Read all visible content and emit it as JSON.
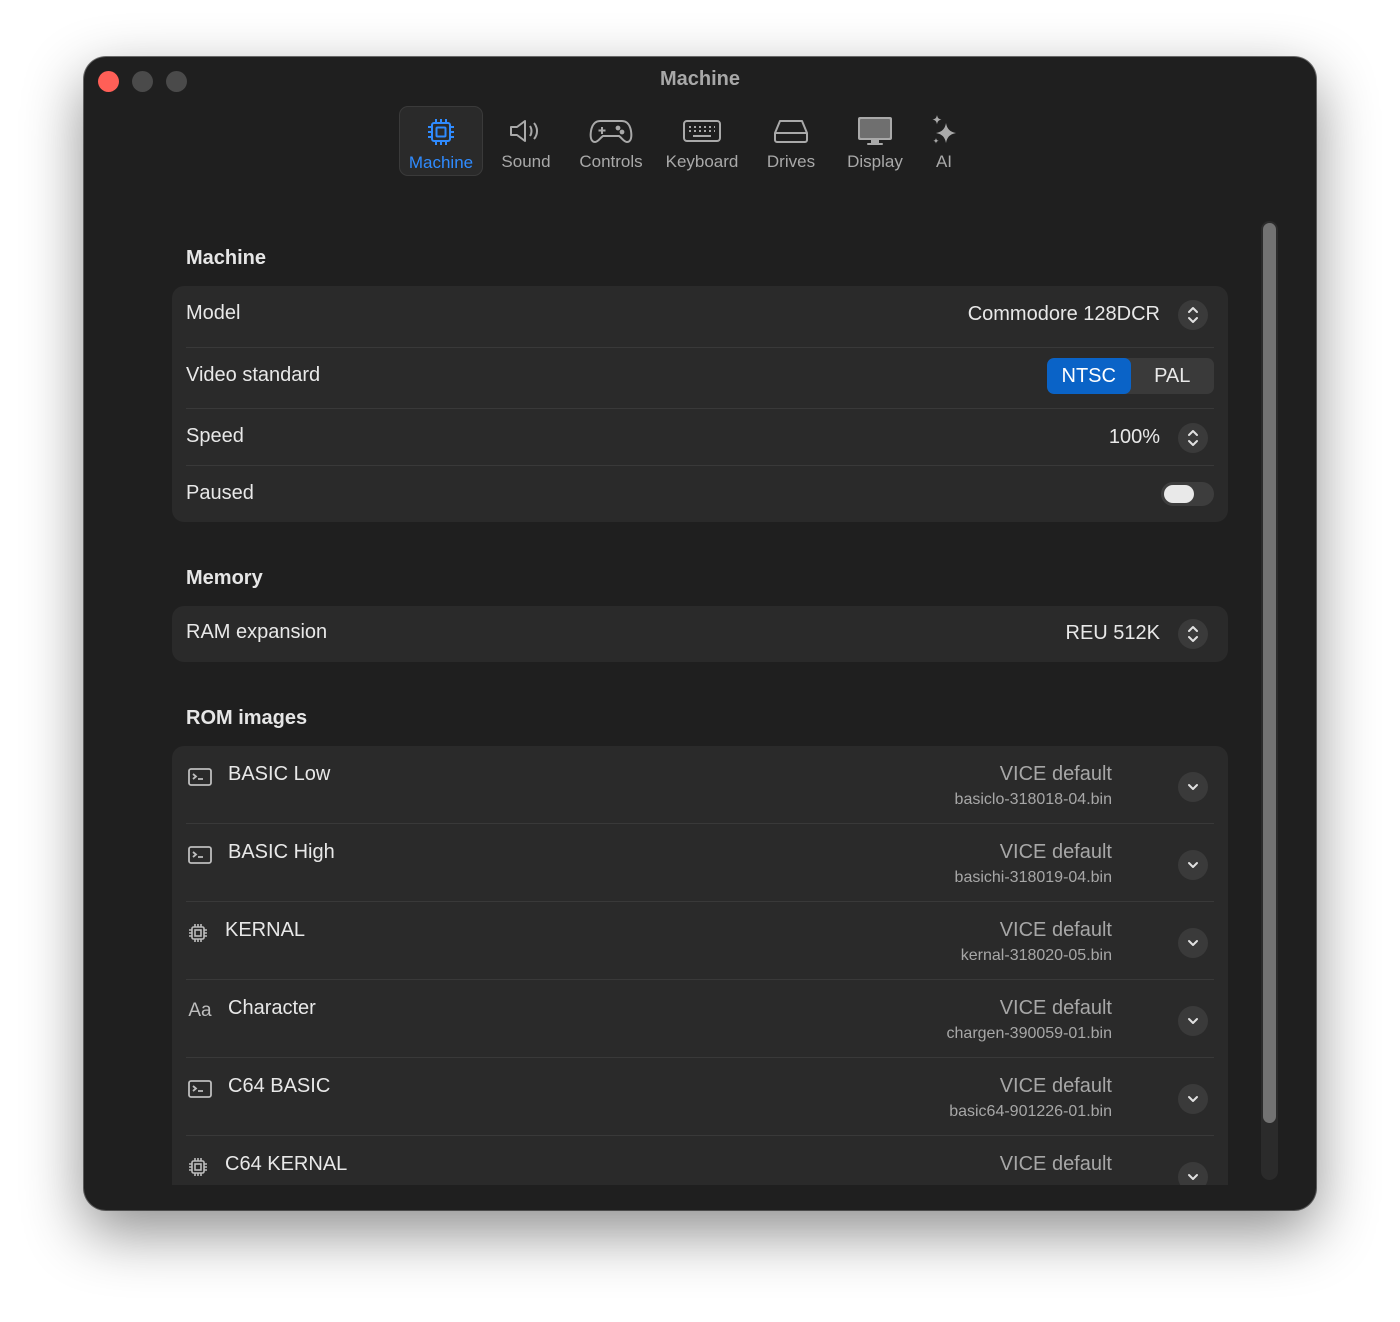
{
  "window": {
    "title": "Machine"
  },
  "toolbar": {
    "tabs": [
      {
        "label": "Machine",
        "icon": "cpu-chip-icon",
        "active": true
      },
      {
        "label": "Sound",
        "icon": "speaker-icon"
      },
      {
        "label": "Controls",
        "icon": "gamepad-icon"
      },
      {
        "label": "Keyboard",
        "icon": "keyboard-icon"
      },
      {
        "label": "Drives",
        "icon": "drive-icon"
      },
      {
        "label": "Display",
        "icon": "display-icon"
      },
      {
        "label": "AI",
        "icon": "sparkles-icon"
      }
    ]
  },
  "machine": {
    "title": "Machine",
    "model_label": "Model",
    "model_value": "Commodore 128DCR",
    "video_label": "Video standard",
    "video_options": [
      "NTSC",
      "PAL"
    ],
    "video_selected": "NTSC",
    "speed_label": "Speed",
    "speed_value": "100%",
    "paused_label": "Paused",
    "paused": false
  },
  "memory": {
    "title": "Memory",
    "ram_label": "RAM expansion",
    "ram_value": "REU 512K"
  },
  "rom": {
    "title": "ROM images",
    "items": [
      {
        "label": "BASIC Low",
        "icon": "terminal-icon",
        "source": "VICE default",
        "file": "basiclo-318018-04.bin"
      },
      {
        "label": "BASIC High",
        "icon": "terminal-icon",
        "source": "VICE default",
        "file": "basichi-318019-04.bin"
      },
      {
        "label": "KERNAL",
        "icon": "chip-icon",
        "source": "VICE default",
        "file": "kernal-318020-05.bin"
      },
      {
        "label": "Character",
        "icon": "font-icon",
        "icon_text": "Aa",
        "source": "VICE default",
        "file": "chargen-390059-01.bin"
      },
      {
        "label": "C64 BASIC",
        "icon": "terminal-icon",
        "source": "VICE default",
        "file": "basic64-901226-01.bin"
      },
      {
        "label": "C64 KERNAL",
        "icon": "chip-icon",
        "source": "VICE default",
        "file": ""
      }
    ]
  },
  "colors": {
    "accent": "#2f8bff",
    "segment_on": "#0a63c7",
    "close": "#ff5f57"
  }
}
